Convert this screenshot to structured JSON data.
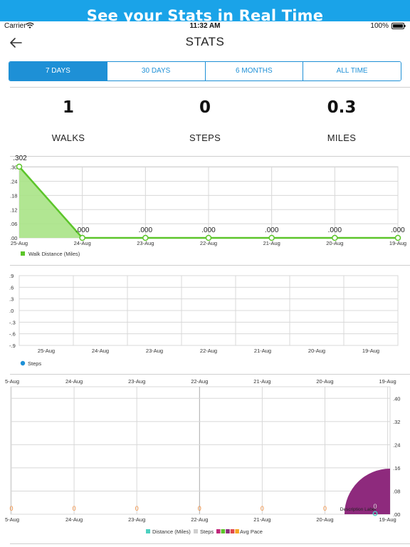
{
  "banner": {
    "text": "See your Stats in Real Time"
  },
  "status_bar": {
    "carrier": "Carrier",
    "time": "11:32 AM",
    "battery": "100%"
  },
  "nav": {
    "title": "STATS"
  },
  "segments": [
    {
      "label": "7 DAYS",
      "active": true
    },
    {
      "label": "30 DAYS",
      "active": false
    },
    {
      "label": "6 MONTHS",
      "active": false
    },
    {
      "label": "ALL TIME",
      "active": false
    }
  ],
  "stats": [
    {
      "value": "1",
      "label": "WALKS"
    },
    {
      "value": "0",
      "label": "STEPS"
    },
    {
      "value": "0.3",
      "label": "MILES"
    }
  ],
  "colors": {
    "accent": "#1e90d6",
    "banner": "#1aa3e8",
    "walk_line": "#5cc52a",
    "walk_fill": "#a9e386",
    "steps": "#1e90d6",
    "distance_legend": "#4dd0c0",
    "steps_legend": "#d0d0d0",
    "avg_pace_points": "#f28b3a",
    "description_label": "#8e2a7d"
  },
  "chart_data": [
    {
      "type": "area",
      "x": [
        "25-Aug",
        "24-Aug",
        "23-Aug",
        "22-Aug",
        "21-Aug",
        "20-Aug",
        "19-Aug"
      ],
      "series": [
        {
          "name": "Walk Distance (Miles)",
          "values": [
            0.302,
            0,
            0,
            0,
            0,
            0,
            0
          ],
          "labels": [
            ".302",
            ".000",
            ".000",
            ".000",
            ".000",
            ".000",
            ".000"
          ]
        }
      ],
      "yticks": [
        ".00",
        ".06",
        ".12",
        ".18",
        ".24",
        ".30"
      ],
      "ylim": [
        0,
        0.302
      ],
      "grid": true,
      "legend": "bottom-left"
    },
    {
      "type": "scatter",
      "x": [
        "25-Aug",
        "24-Aug",
        "23-Aug",
        "22-Aug",
        "21-Aug",
        "20-Aug",
        "19-Aug"
      ],
      "series": [
        {
          "name": "Steps",
          "values": []
        }
      ],
      "yticks": [
        "-.9",
        "-.6",
        "-.3",
        ".0",
        ".3",
        ".6",
        ".9"
      ],
      "ylim": [
        -0.9,
        0.9
      ],
      "grid": true,
      "legend": "bottom-left"
    },
    {
      "type": "line",
      "x": [
        "25-Aug",
        "24-Aug",
        "23-Aug",
        "22-Aug",
        "21-Aug",
        "20-Aug",
        "19-Aug"
      ],
      "x_top_labels": [
        "5-Aug",
        "24-Aug",
        "23-Aug",
        "22-Aug",
        "21-Aug",
        "20-Aug",
        "19-Aug"
      ],
      "x_bottom_labels": [
        "5-Aug",
        "24-Aug",
        "23-Aug",
        "22-Aug",
        "21-Aug",
        "20-Aug",
        "19-Aug"
      ],
      "series": [
        {
          "name": "Distance (Miles)",
          "values": []
        },
        {
          "name": "Steps",
          "values": []
        },
        {
          "name": "Avg Pace",
          "values": [
            0,
            0,
            0,
            0,
            0,
            0,
            0
          ],
          "labels": [
            "0",
            "0",
            "0",
            "0",
            "0",
            "0",
            "0"
          ]
        }
      ],
      "yticks_right": [
        ".00",
        ".08",
        ".16",
        ".24",
        ".32",
        ".40"
      ],
      "ylim": [
        0,
        0.44
      ],
      "grid": true,
      "legend": "bottom-center",
      "description_label": "Description Label",
      "bubble_label": "0"
    }
  ]
}
